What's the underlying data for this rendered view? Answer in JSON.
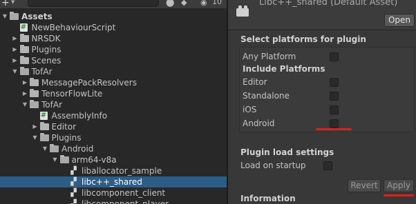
{
  "project": {
    "hidden_count": "10",
    "tree": [
      {
        "label": "Assets",
        "depth": 0,
        "kind": "folder",
        "expanded": true,
        "bold": true
      },
      {
        "label": "NewBehaviourScript",
        "depth": 1,
        "kind": "script"
      },
      {
        "label": "NRSDK",
        "depth": 1,
        "kind": "folder",
        "expanded": false
      },
      {
        "label": "Plugins",
        "depth": 1,
        "kind": "folder",
        "expanded": false
      },
      {
        "label": "Scenes",
        "depth": 1,
        "kind": "folder",
        "expanded": false
      },
      {
        "label": "TofAr",
        "depth": 1,
        "kind": "folder",
        "expanded": true
      },
      {
        "label": "MessagePackResolvers",
        "depth": 2,
        "kind": "folder",
        "expanded": false
      },
      {
        "label": "TensorFlowLite",
        "depth": 2,
        "kind": "folder",
        "expanded": false
      },
      {
        "label": "TofAr",
        "depth": 2,
        "kind": "folder",
        "expanded": true
      },
      {
        "label": "AssemblyInfo",
        "depth": 3,
        "kind": "script"
      },
      {
        "label": "Editor",
        "depth": 3,
        "kind": "folder",
        "expanded": false
      },
      {
        "label": "Plugins",
        "depth": 3,
        "kind": "folder",
        "expanded": true
      },
      {
        "label": "Android",
        "depth": 4,
        "kind": "folder",
        "expanded": true
      },
      {
        "label": "arm64-v8a",
        "depth": 5,
        "kind": "folder",
        "expanded": true
      },
      {
        "label": "liballocator_sample",
        "depth": 6,
        "kind": "plugin"
      },
      {
        "label": "libc++_shared",
        "depth": 6,
        "kind": "plugin",
        "selected": true
      },
      {
        "label": "libcomponent_client",
        "depth": 6,
        "kind": "plugin"
      },
      {
        "label": "libcomponent_player",
        "depth": 6,
        "kind": "plugin"
      }
    ]
  },
  "inspector": {
    "title": "Libc++_shared (Default Asset)",
    "open_label": "Open",
    "platforms_title": "Select platforms for plugin",
    "any_platform": "Any Platform",
    "include_platforms": "Include Platforms",
    "platforms": [
      "Editor",
      "Standalone",
      "iOS",
      "Android"
    ],
    "load_settings_title": "Plugin load settings",
    "load_on_startup": "Load on startup",
    "revert_label": "Revert",
    "apply_label": "Apply",
    "information_title": "Information"
  },
  "colors": {
    "selection": "#2c5d87",
    "annotation": "#e0201d",
    "panel_left": "#282828",
    "panel_right": "#383838"
  }
}
